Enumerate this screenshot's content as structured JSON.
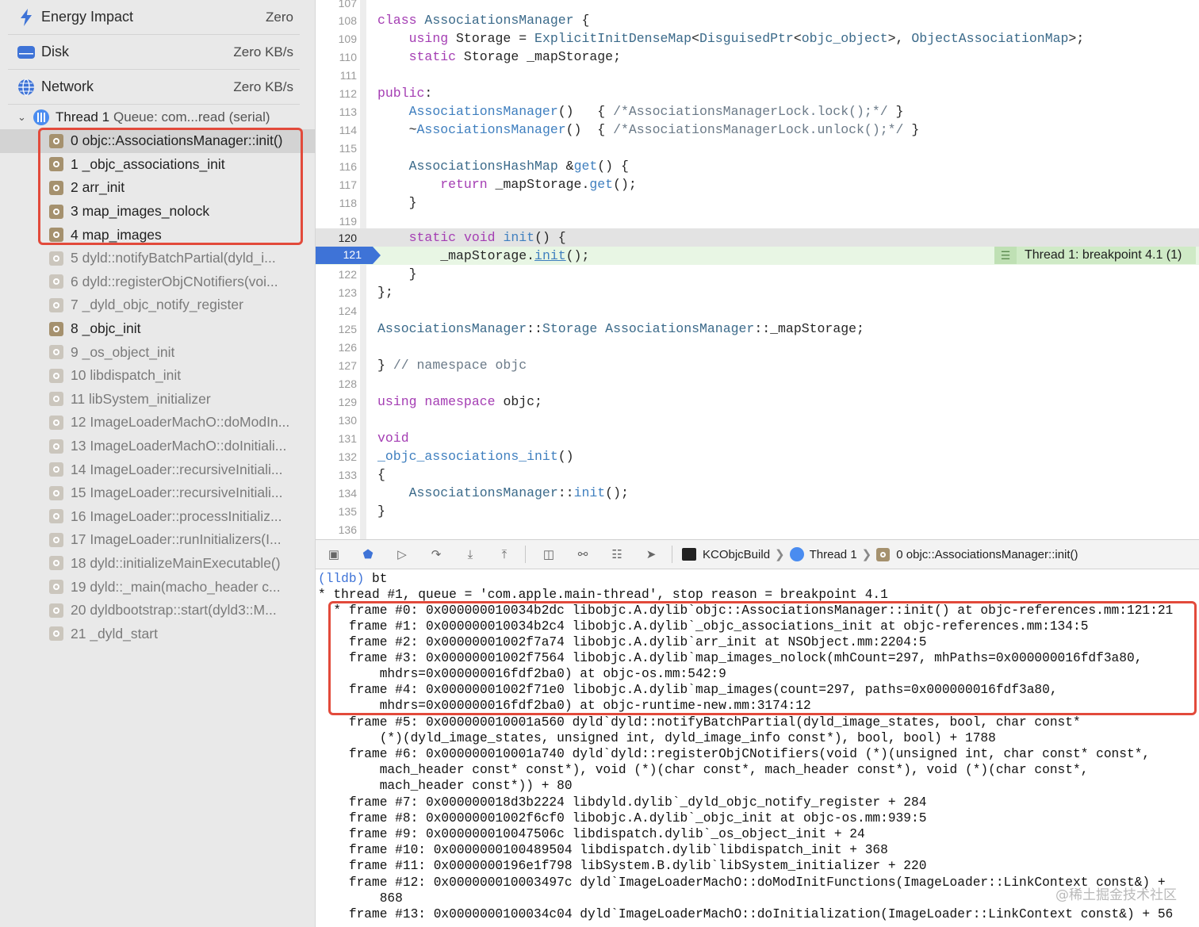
{
  "gauges": [
    {
      "name": "Energy Impact",
      "value": "Zero",
      "icon": "bolt-icon",
      "color": "#3e73d7"
    },
    {
      "name": "Disk",
      "value": "Zero KB/s",
      "icon": "disk-icon",
      "color": "#3e73d7"
    },
    {
      "name": "Network",
      "value": "Zero KB/s",
      "icon": "globe-icon",
      "color": "#3e73d7"
    }
  ],
  "thread": {
    "title": "Thread 1",
    "queue": "Queue: com...read (serial)"
  },
  "frames": [
    "0 objc::AssociationsManager::init()",
    "1 _objc_associations_init",
    "2 arr_init",
    "3 map_images_nolock",
    "4 map_images",
    "5 dyld::notifyBatchPartial(dyld_i...",
    "6 dyld::registerObjCNotifiers(voi...",
    "7 _dyld_objc_notify_register",
    "8 _objc_init",
    "9 _os_object_init",
    "10 libdispatch_init",
    "11 libSystem_initializer",
    "12 ImageLoaderMachO::doModIn...",
    "13 ImageLoaderMachO::doInitiali...",
    "14 ImageLoader::recursiveInitiali...",
    "15 ImageLoader::recursiveInitiali...",
    "16 ImageLoader::processInitializ...",
    "17 ImageLoader::runInitializers(I...",
    "18 dyld::initializeMainExecutable()",
    "19 dyld::_main(macho_header c...",
    "20 dyldbootstrap::start(dyld3::M...",
    "21 _dyld_start"
  ],
  "editor": {
    "line_numbers": [
      "107",
      "108",
      "109",
      "110",
      "111",
      "112",
      "113",
      "114",
      "115",
      "116",
      "117",
      "118",
      "119",
      "120",
      "121",
      "122",
      "123",
      "124",
      "125",
      "126",
      "127",
      "128",
      "129",
      "130",
      "131",
      "132",
      "133",
      "134",
      "135",
      "136"
    ],
    "current_line": "121",
    "breakpoint_label": "Thread 1: breakpoint 4.1 (1)"
  },
  "debug_bar": {
    "target": "KCObjcBuild",
    "thread": "Thread 1",
    "frame": "0 objc::AssociationsManager::init()"
  },
  "console": {
    "prompt": "(lldb)",
    "command": " bt",
    "lines": [
      "* thread #1, queue = 'com.apple.main-thread', stop reason = breakpoint 4.1",
      "  * frame #0: 0x000000010034b2dc libobjc.A.dylib`objc::AssociationsManager::init() at objc-references.mm:121:21",
      "    frame #1: 0x000000010034b2c4 libobjc.A.dylib`_objc_associations_init at objc-references.mm:134:5",
      "    frame #2: 0x00000001002f7a74 libobjc.A.dylib`arr_init at NSObject.mm:2204:5",
      "    frame #3: 0x00000001002f7564 libobjc.A.dylib`map_images_nolock(mhCount=297, mhPaths=0x000000016fdf3a80,",
      "        mhdrs=0x000000016fdf2ba0) at objc-os.mm:542:9",
      "    frame #4: 0x00000001002f71e0 libobjc.A.dylib`map_images(count=297, paths=0x000000016fdf3a80,",
      "        mhdrs=0x000000016fdf2ba0) at objc-runtime-new.mm:3174:12",
      "    frame #5: 0x000000010001a560 dyld`dyld::notifyBatchPartial(dyld_image_states, bool, char const*",
      "        (*)(dyld_image_states, unsigned int, dyld_image_info const*), bool, bool) + 1788",
      "    frame #6: 0x000000010001a740 dyld`dyld::registerObjCNotifiers(void (*)(unsigned int, char const* const*,",
      "        mach_header const* const*), void (*)(char const*, mach_header const*), void (*)(char const*,",
      "        mach_header const*)) + 80",
      "    frame #7: 0x000000018d3b2224 libdyld.dylib`_dyld_objc_notify_register + 284",
      "    frame #8: 0x00000001002f6cf0 libobjc.A.dylib`_objc_init at objc-os.mm:939:5",
      "    frame #9: 0x000000010047506c libdispatch.dylib`_os_object_init + 24",
      "    frame #10: 0x0000000100489504 libdispatch.dylib`libdispatch_init + 368",
      "    frame #11: 0x0000000196e1f798 libSystem.B.dylib`libSystem_initializer + 220",
      "    frame #12: 0x000000010003497c dyld`ImageLoaderMachO::doModInitFunctions(ImageLoader::LinkContext const&) +",
      "        868",
      "    frame #13: 0x0000000100034c04 dyld`ImageLoaderMachO::doInitialization(ImageLoader::LinkContext const&) + 56"
    ],
    "watermark": "@稀土掘金技术社区"
  },
  "colors": {
    "highlight": "#e24a3b",
    "accent": "#3e73d7"
  }
}
